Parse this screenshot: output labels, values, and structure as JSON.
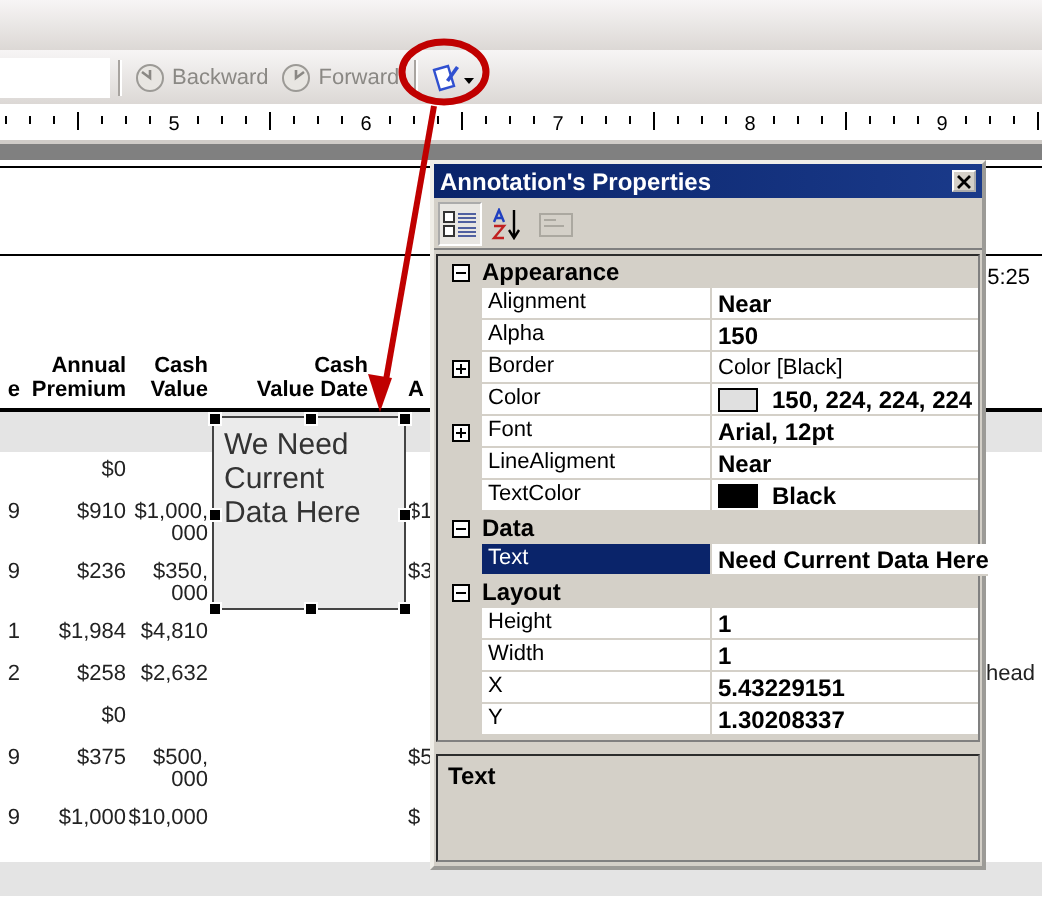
{
  "toolbar": {
    "buttons": [
      {
        "kind": "backward",
        "label": "Backward",
        "disabled": true
      },
      {
        "kind": "forward",
        "label": "Forward",
        "disabled": true
      }
    ]
  },
  "ruler": {
    "labels": [
      "5",
      "6",
      "7",
      "8",
      "9"
    ]
  },
  "report": {
    "time": "5:25",
    "columns": [
      {
        "header": "e"
      },
      {
        "header": "Annual\nPremium"
      },
      {
        "header": "Cash\nValue"
      },
      {
        "header": "Cash\nValue Date"
      },
      {
        "header": "A"
      }
    ],
    "rows": [
      {
        "cells": [
          "",
          "$0",
          "",
          "",
          ""
        ]
      },
      {
        "cells": [
          "9",
          "$910",
          "$1,000,\n000",
          "",
          "$1"
        ]
      },
      {
        "cells": [
          "9",
          "$236",
          "$350,\n000",
          "",
          "$3"
        ]
      },
      {
        "cells": [
          "1",
          "$1,984",
          "$4,810",
          "",
          ""
        ]
      },
      {
        "cells": [
          "2",
          "$258",
          "$2,632",
          "",
          ""
        ],
        "note": "head"
      },
      {
        "cells": [
          "",
          "$0",
          "",
          "",
          ""
        ]
      },
      {
        "cells": [
          "9",
          "$375",
          "$500,\n000",
          "",
          "$5"
        ]
      },
      {
        "cells": [
          "9",
          "$1,000",
          "$10,000",
          "",
          "$"
        ]
      }
    ]
  },
  "annotation": {
    "text": "We Need Current Data Here"
  },
  "properties_window": {
    "title": "Annotation's Properties",
    "view_buttons": [
      {
        "kind": "categorized",
        "selected": true,
        "disabled": false
      },
      {
        "kind": "alphabetical",
        "selected": false,
        "disabled": false
      },
      {
        "kind": "property-pages",
        "selected": false,
        "disabled": true
      }
    ],
    "groups": [
      {
        "name": "Appearance",
        "expanded": true,
        "properties": [
          {
            "kind": "text",
            "name": "Alignment",
            "value": "Near",
            "modified": true,
            "selected": false
          },
          {
            "kind": "text",
            "name": "Alpha",
            "value": "150",
            "modified": true,
            "selected": false
          },
          {
            "kind": "expandable",
            "name": "Border",
            "value": "Color [Black]",
            "modified": false,
            "selected": false,
            "expanded": false
          },
          {
            "kind": "swatch",
            "name": "Color",
            "value": "150, 224, 224, 224",
            "modified": true,
            "selected": false,
            "color": "#e0e0e0"
          },
          {
            "kind": "expandable",
            "name": "Font",
            "value": "Arial, 12pt",
            "modified": true,
            "selected": false,
            "expanded": false
          },
          {
            "kind": "text",
            "name": "LineAligment",
            "value": "Near",
            "modified": true,
            "selected": false
          },
          {
            "kind": "swatch",
            "name": "TextColor",
            "value": "Black",
            "modified": true,
            "selected": false,
            "color": "#000000"
          }
        ]
      },
      {
        "name": "Data",
        "expanded": true,
        "properties": [
          {
            "kind": "text",
            "name": "Text",
            "value": "Need Current Data Here",
            "modified": true,
            "selected": true
          }
        ]
      },
      {
        "name": "Layout",
        "expanded": true,
        "properties": [
          {
            "kind": "text",
            "name": "Height",
            "value": "1",
            "modified": true,
            "selected": false
          },
          {
            "kind": "text",
            "name": "Width",
            "value": "1",
            "modified": true,
            "selected": false
          },
          {
            "kind": "text",
            "name": "X",
            "value": "5.43229151",
            "modified": true,
            "selected": false
          },
          {
            "kind": "text",
            "name": "Y",
            "value": "1.30208337",
            "modified": true,
            "selected": false
          }
        ]
      }
    ],
    "description": "Text"
  }
}
